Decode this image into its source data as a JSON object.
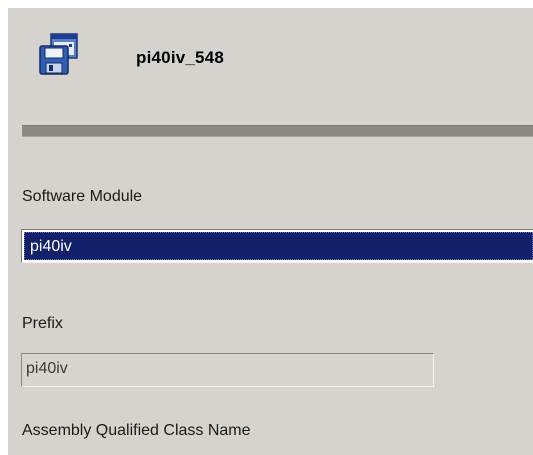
{
  "header": {
    "title": "pi40iv_548",
    "icon": "software-module-icon"
  },
  "fields": {
    "software_module": {
      "label": "Software Module",
      "value": "pi40iv"
    },
    "prefix": {
      "label": "Prefix",
      "value": "pi40iv"
    },
    "assembly_qualified_class_name": {
      "label": "Assembly Qualified Class Name"
    }
  },
  "colors": {
    "background": "#d6d3ce",
    "selection": "#12216a",
    "divider": "#8c8a86"
  }
}
